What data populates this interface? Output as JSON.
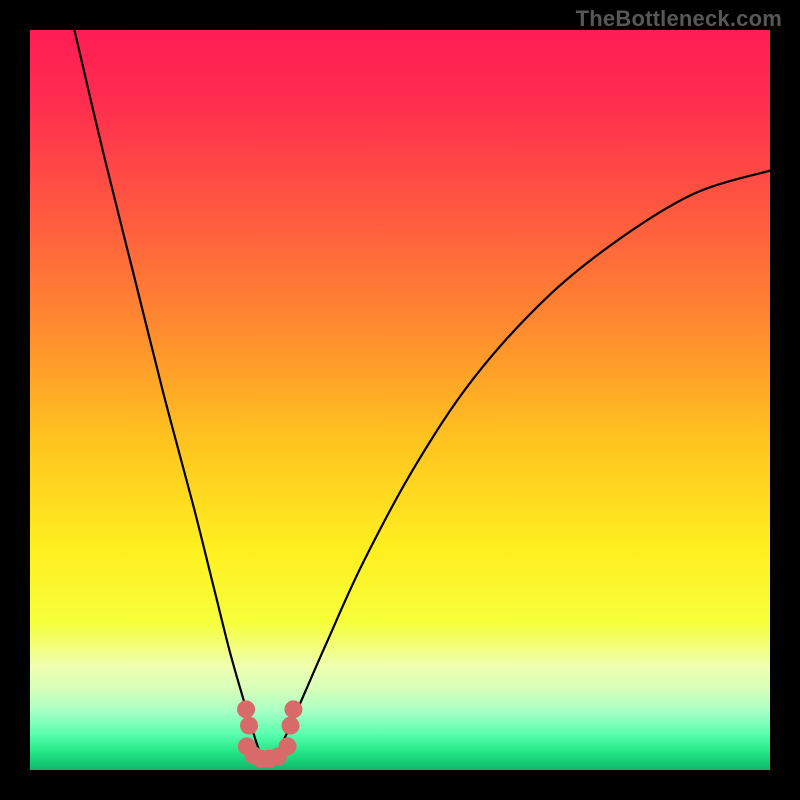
{
  "watermark": "TheBottleneck.com",
  "chart_data": {
    "type": "line",
    "title": "",
    "xlabel": "",
    "ylabel": "",
    "xlim": [
      0,
      100
    ],
    "ylim": [
      0,
      100
    ],
    "series": [
      {
        "name": "curve",
        "x": [
          6,
          10,
          14,
          18,
          22,
          25,
          27,
          29,
          30.5,
          31.5,
          32.5,
          34,
          36.5,
          40,
          45,
          52,
          60,
          70,
          80,
          90,
          100
        ],
        "y": [
          100,
          83,
          67,
          51,
          36,
          24,
          16,
          9,
          4,
          1.5,
          1.5,
          3.5,
          9,
          17,
          28,
          41,
          53,
          64,
          72,
          78,
          81
        ]
      }
    ],
    "markers": {
      "name": "valley-dots",
      "color": "#d86a6a",
      "points": [
        {
          "x": 29.2,
          "y": 8.2
        },
        {
          "x": 29.6,
          "y": 6.0
        },
        {
          "x": 29.3,
          "y": 3.2
        },
        {
          "x": 30.2,
          "y": 2.0
        },
        {
          "x": 31.2,
          "y": 1.5
        },
        {
          "x": 32.3,
          "y": 1.5
        },
        {
          "x": 33.5,
          "y": 1.8
        },
        {
          "x": 34.8,
          "y": 3.2
        },
        {
          "x": 35.2,
          "y": 6.0
        },
        {
          "x": 35.6,
          "y": 8.2
        }
      ]
    },
    "background_gradient": {
      "stops": [
        {
          "offset": 0.0,
          "color": "#ff1d54"
        },
        {
          "offset": 0.1,
          "color": "#ff2e4e"
        },
        {
          "offset": 0.25,
          "color": "#ff5a3f"
        },
        {
          "offset": 0.4,
          "color": "#ff8a2f"
        },
        {
          "offset": 0.55,
          "color": "#ffc21f"
        },
        {
          "offset": 0.7,
          "color": "#ffef1f"
        },
        {
          "offset": 0.8,
          "color": "#f6ff3a"
        },
        {
          "offset": 0.86,
          "color": "#efffb0"
        },
        {
          "offset": 0.89,
          "color": "#d8ffba"
        },
        {
          "offset": 0.92,
          "color": "#a8ffc4"
        },
        {
          "offset": 0.95,
          "color": "#5dffb0"
        },
        {
          "offset": 0.975,
          "color": "#23e887"
        },
        {
          "offset": 1.0,
          "color": "#0fb76a"
        }
      ]
    }
  }
}
